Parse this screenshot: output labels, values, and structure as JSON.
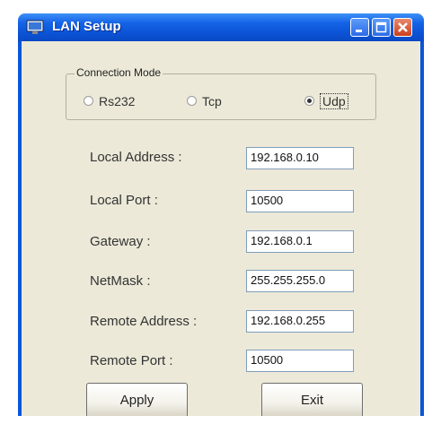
{
  "window": {
    "title": "LAN Setup"
  },
  "connection_mode": {
    "label": "Connection Mode",
    "options": [
      {
        "label": "Rs232",
        "selected": false
      },
      {
        "label": "Tcp",
        "selected": false
      },
      {
        "label": "Udp",
        "selected": true
      }
    ]
  },
  "fields": [
    {
      "label": "Local Address :",
      "value": "192.168.0.10"
    },
    {
      "label": "Local Port :",
      "value": "10500"
    },
    {
      "label": "Gateway :",
      "value": "192.168.0.1"
    },
    {
      "label": "NetMask :",
      "value": "255.255.255.0"
    },
    {
      "label": "Remote Address :",
      "value": "192.168.0.255"
    },
    {
      "label": "Remote Port :",
      "value": "10500"
    }
  ],
  "buttons": {
    "apply": "Apply",
    "exit": "Exit"
  },
  "icons": {
    "app": "computer-icon",
    "minimize": "minimize-icon",
    "maximize": "maximize-icon",
    "close": "close-icon"
  },
  "colors": {
    "titlebar": "#0b53d6",
    "client": "#ece9d8",
    "close": "#c9401e"
  }
}
